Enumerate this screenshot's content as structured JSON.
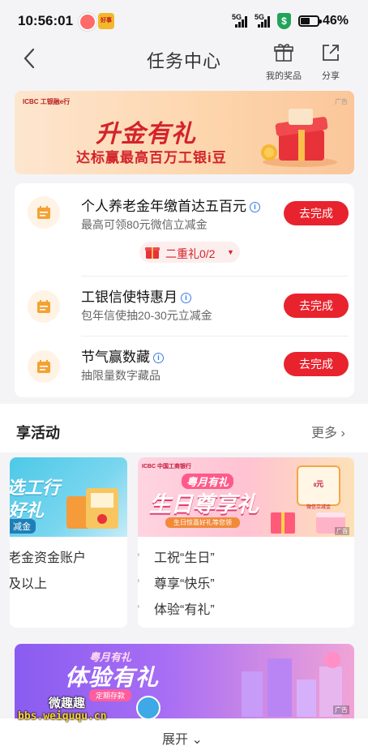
{
  "status_bar": {
    "time": "10:56:01",
    "network1": "5G",
    "network2": "5G",
    "battery": "46%",
    "app_badge": "好事"
  },
  "header": {
    "title": "任务中心",
    "my_prizes": "我的奖品",
    "share": "分享"
  },
  "banner": {
    "logo": "ICBC 工银融e行",
    "ad_tag": "广告",
    "headline": "升金有礼",
    "subline": "达标赢最高百万工银i豆"
  },
  "tasks": [
    {
      "name": "个人养老金年缴首达五百元",
      "desc": "最高可领80元微信立减金",
      "action": "去完成"
    },
    {
      "name": "工银信使特惠月",
      "desc": "包年信使抽20-30元立减金",
      "action": "去完成"
    },
    {
      "name": "节气赢数藏",
      "desc": "抽限量数字藏品",
      "action": "去完成"
    }
  ],
  "bonus": {
    "label": "二重礼0/2"
  },
  "activities": {
    "title": "享活动",
    "more": "更多",
    "card1": {
      "img_line1": "选工行",
      "img_line2": "好礼",
      "img_tag": "减金",
      "lines": [
        "老金资金账户",
        "及以上"
      ]
    },
    "card2": {
      "img_logo": "ICBC 中国工商银行",
      "img_tag": "粤月有礼",
      "img_title": "生日尊享礼",
      "img_sub": "生日惊喜好礼等您领",
      "ticket_value": "8",
      "ticket_unit": "元",
      "ticket_note": "微信立减金",
      "ad_tag": "广告",
      "bullets": [
        "工祝“生日”",
        "尊享“快乐”",
        "体验“有礼”"
      ]
    }
  },
  "bottom_banner": {
    "tag": "粤月有礼",
    "title": "体验有礼",
    "sub": "定期存款",
    "ad_tag": "广告"
  },
  "expand": "展开",
  "watermark": {
    "line1": "微趣趣",
    "line2": "bbs.weiququ.cn"
  }
}
